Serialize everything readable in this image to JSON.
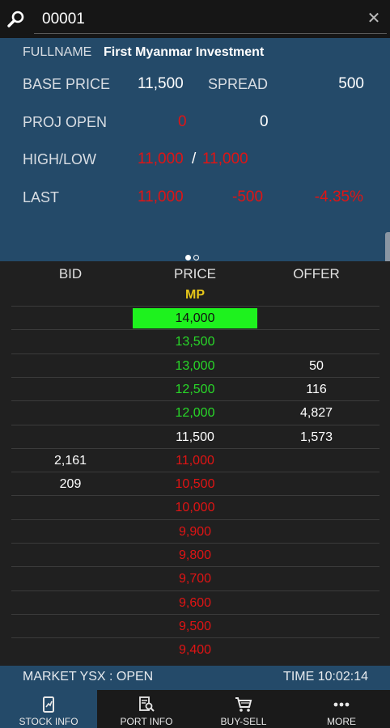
{
  "search": {
    "value": "00001"
  },
  "info": {
    "fullname_label": "FULLNAME",
    "fullname": "First Myanmar Investment",
    "base_price_label": "BASE PRICE",
    "base_price": "11,500",
    "spread_label": "SPREAD",
    "spread": "500",
    "proj_open_label": "PROJ OPEN",
    "proj_open_price": "0",
    "proj_open_qty": "0",
    "high_low_label": "HIGH/LOW",
    "high": "11,000",
    "separator": "/",
    "low": "11,000",
    "last_label": "LAST",
    "last": "11,000",
    "change": "-500",
    "change_pct": "-4.35%"
  },
  "pager": {
    "pages": 2,
    "active": 1
  },
  "book": {
    "headers": {
      "bid": "BID",
      "price": "PRICE",
      "offer": "OFFER"
    },
    "mp_label": "MP",
    "rows": [
      {
        "bid": "",
        "price": "14,000",
        "offer": "",
        "color": "highlight"
      },
      {
        "bid": "",
        "price": "13,500",
        "offer": "",
        "color": "green"
      },
      {
        "bid": "",
        "price": "13,000",
        "offer": "50",
        "color": "green"
      },
      {
        "bid": "",
        "price": "12,500",
        "offer": "116",
        "color": "green"
      },
      {
        "bid": "",
        "price": "12,000",
        "offer": "4,827",
        "color": "green"
      },
      {
        "bid": "",
        "price": "11,500",
        "offer": "1,573",
        "color": "white"
      },
      {
        "bid": "2,161",
        "price": "11,000",
        "offer": "",
        "color": "red"
      },
      {
        "bid": "209",
        "price": "10,500",
        "offer": "",
        "color": "red"
      },
      {
        "bid": "",
        "price": "10,000",
        "offer": "",
        "color": "red"
      },
      {
        "bid": "",
        "price": "9,900",
        "offer": "",
        "color": "red"
      },
      {
        "bid": "",
        "price": "9,800",
        "offer": "",
        "color": "red"
      },
      {
        "bid": "",
        "price": "9,700",
        "offer": "",
        "color": "red"
      },
      {
        "bid": "",
        "price": "9,600",
        "offer": "",
        "color": "red"
      },
      {
        "bid": "",
        "price": "9,500",
        "offer": "",
        "color": "red"
      },
      {
        "bid": "",
        "price": "9,400",
        "offer": "",
        "color": "red"
      }
    ]
  },
  "status": {
    "market": "MARKET YSX : OPEN",
    "time": "TIME 10:02:14"
  },
  "nav": {
    "items": [
      {
        "label": "STOCK INFO",
        "icon": "stock-info-icon",
        "active": true
      },
      {
        "label": "PORT INFO",
        "icon": "port-info-icon",
        "active": false
      },
      {
        "label": "BUY-SELL",
        "icon": "cart-icon",
        "active": false
      },
      {
        "label": "MORE",
        "icon": "more-icon",
        "active": false
      }
    ]
  },
  "colors": {
    "panel": "#244a69",
    "up": "#28d728",
    "down": "#e01414",
    "highlight": "#1ef21e",
    "mp": "#e6c619"
  }
}
